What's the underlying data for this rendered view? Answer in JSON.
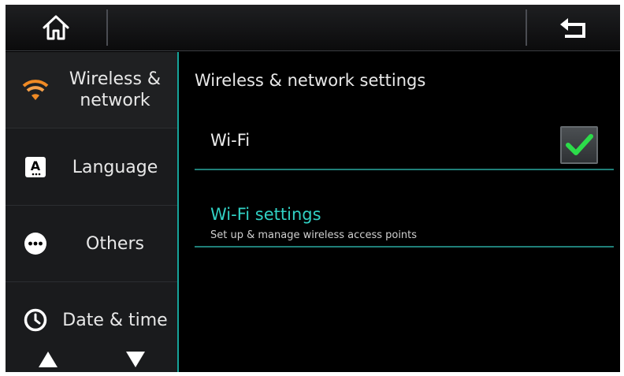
{
  "topbar": {
    "home_icon": "home-icon",
    "back_icon": "back-arrow-icon"
  },
  "sidebar": {
    "items": [
      {
        "label_line1": "Wireless &",
        "label_line2": "network",
        "icon": "wifi-icon"
      },
      {
        "label": "Language",
        "icon": "language-icon"
      },
      {
        "label": "Others",
        "icon": "more-dots-icon"
      },
      {
        "label": "Date & time",
        "icon": "clock-icon"
      }
    ],
    "up_icon": "triangle-up-icon",
    "down_icon": "triangle-down-icon"
  },
  "main": {
    "section_title": "Wireless & network settings",
    "wifi": {
      "label": "Wi-Fi",
      "checked": true
    },
    "wifi_settings": {
      "title": "Wi-Fi settings",
      "subtitle": "Set up & manage wireless access points"
    }
  },
  "colors": {
    "accent": "#31d1c4",
    "divider": "#1f7f78",
    "check": "#2cdc4a",
    "wifi_orange": "#f08a24"
  }
}
